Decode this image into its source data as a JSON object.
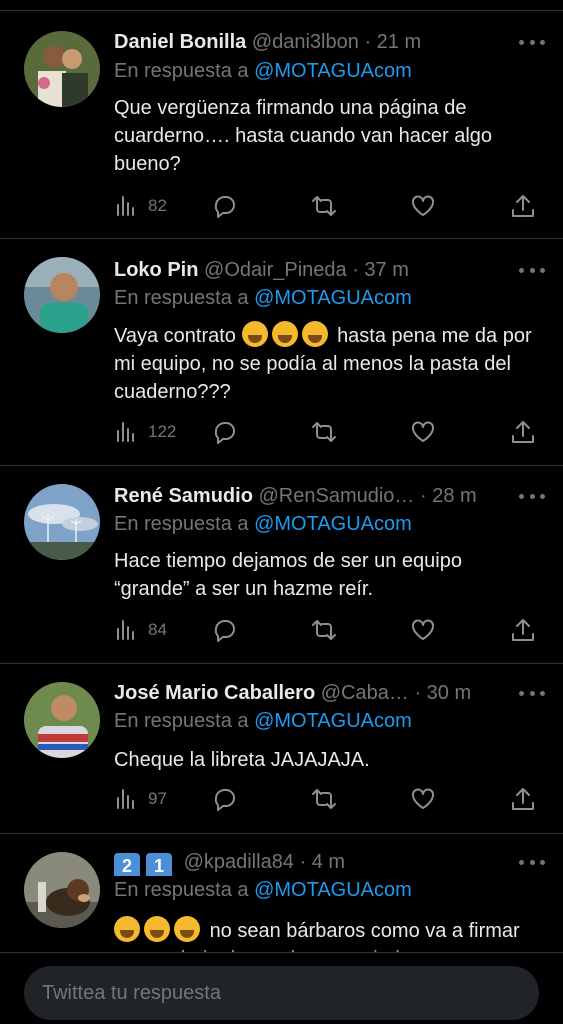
{
  "tweets": [
    {
      "name": "Daniel Bonilla",
      "handle": "@dani3lbon",
      "time": "· 21 m",
      "reply_prefix": "En respuesta a",
      "reply_to": "@MOTAGUAcom",
      "text": "Que vergüenza firmando una página de cuarderno…. hasta cuando van hacer algo bueno?",
      "views": "82"
    },
    {
      "name": "Loko Pin",
      "handle": "@Odair_Pineda",
      "time": "· 37 m",
      "reply_prefix": "En respuesta a",
      "reply_to": "@MOTAGUAcom",
      "text_before": "Vaya contrato",
      "text_after": "hasta pena me da por mi equipo, no se podía al menos la pasta del cuaderno???",
      "views": "122"
    },
    {
      "name": "René Samudio",
      "handle": "@RenSamudio…",
      "time": "· 28 m",
      "reply_prefix": "En respuesta a",
      "reply_to": "@MOTAGUAcom",
      "text": "Hace tiempo dejamos de ser un equipo “grande” a ser un hazme reír.",
      "views": "84"
    },
    {
      "name": "José Mario Caballero",
      "handle": "@Caba…",
      "time": "· 30 m",
      "reply_prefix": "En respuesta a",
      "reply_to": "@MOTAGUAcom",
      "text": "Cheque la libreta JAJAJAJA.",
      "views": "97"
    },
    {
      "name_digit_1": "2",
      "name_digit_2": "1",
      "handle": "@kpadilla84",
      "time": "· 4 m",
      "reply_prefix": "En respuesta a",
      "reply_to": "@MOTAGUAcom",
      "text": "no sean bárbaros como va a firmar en una hoja de cuaderno espiral"
    }
  ],
  "composer": {
    "placeholder": "Twittea tu respuesta"
  },
  "colors": {
    "background": "#000000",
    "accent": "#1d9bf0",
    "muted": "#71767b",
    "divider": "#2f3336"
  },
  "icons": [
    "views-icon",
    "reply-icon",
    "retweet-icon",
    "like-icon",
    "share-icon",
    "more-icon"
  ]
}
